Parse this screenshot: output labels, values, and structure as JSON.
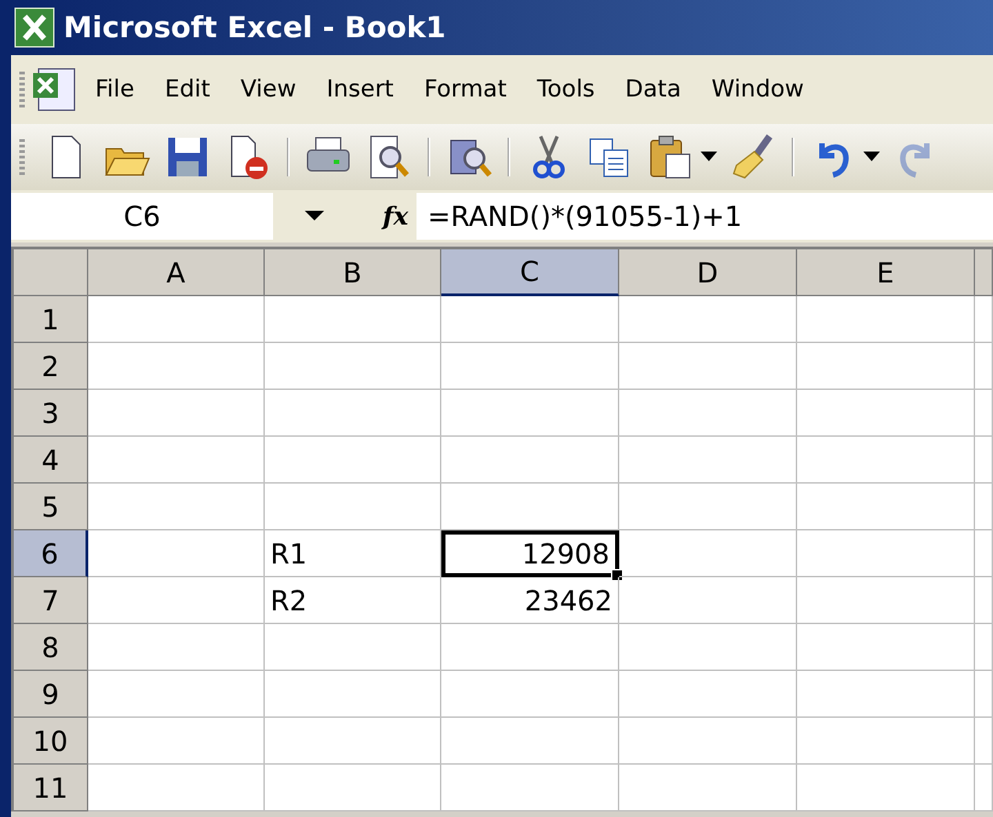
{
  "window": {
    "title": "Microsoft Excel - Book1"
  },
  "menu": [
    "File",
    "Edit",
    "View",
    "Insert",
    "Format",
    "Tools",
    "Data",
    "Window"
  ],
  "toolbar": [
    {
      "kind": "new",
      "disabled": false
    },
    {
      "kind": "open",
      "disabled": false
    },
    {
      "kind": "save",
      "disabled": false
    },
    {
      "kind": "permission",
      "disabled": false
    },
    {
      "kind": "separator"
    },
    {
      "kind": "print",
      "disabled": false
    },
    {
      "kind": "preview",
      "disabled": false
    },
    {
      "kind": "separator"
    },
    {
      "kind": "research",
      "disabled": false
    },
    {
      "kind": "separator"
    },
    {
      "kind": "cut",
      "disabled": false
    },
    {
      "kind": "copy",
      "disabled": false
    },
    {
      "kind": "paste",
      "disabled": false
    },
    {
      "kind": "dropdown"
    },
    {
      "kind": "painter",
      "disabled": false
    },
    {
      "kind": "separator"
    },
    {
      "kind": "undo",
      "disabled": false
    },
    {
      "kind": "dropdown"
    },
    {
      "kind": "redo",
      "disabled": true
    }
  ],
  "formula_bar": {
    "name_box": "C6",
    "function_label": "fx",
    "formula": "=RAND()*(91055-1)+1"
  },
  "sheet": {
    "columns": [
      {
        "label": "A",
        "selected": false
      },
      {
        "label": "B",
        "selected": false
      },
      {
        "label": "C",
        "selected": true
      },
      {
        "label": "D",
        "selected": false
      },
      {
        "label": "E",
        "selected": false
      }
    ],
    "rows": [
      {
        "label": "1",
        "selected": false,
        "cells": [
          {},
          {},
          {},
          {},
          {}
        ]
      },
      {
        "label": "2",
        "selected": false,
        "cells": [
          {},
          {},
          {},
          {},
          {}
        ]
      },
      {
        "label": "3",
        "selected": false,
        "cells": [
          {},
          {},
          {},
          {},
          {}
        ]
      },
      {
        "label": "4",
        "selected": false,
        "cells": [
          {},
          {},
          {},
          {},
          {}
        ]
      },
      {
        "label": "5",
        "selected": false,
        "cells": [
          {},
          {},
          {},
          {},
          {}
        ]
      },
      {
        "label": "6",
        "selected": true,
        "cells": [
          {},
          {
            "text": "R1",
            "kind": "text",
            "active": false
          },
          {
            "text": "12908",
            "kind": "number",
            "active": true
          },
          {},
          {}
        ]
      },
      {
        "label": "7",
        "selected": false,
        "cells": [
          {},
          {
            "text": "R2",
            "kind": "text",
            "active": false
          },
          {
            "text": "23462",
            "kind": "number",
            "active": false
          },
          {},
          {}
        ]
      },
      {
        "label": "8",
        "selected": false,
        "cells": [
          {},
          {},
          {},
          {},
          {}
        ]
      },
      {
        "label": "9",
        "selected": false,
        "cells": [
          {},
          {},
          {},
          {},
          {}
        ]
      },
      {
        "label": "10",
        "selected": false,
        "cells": [
          {},
          {},
          {},
          {},
          {}
        ]
      },
      {
        "label": "11",
        "selected": false,
        "cells": [
          {},
          {},
          {},
          {},
          {}
        ]
      }
    ]
  }
}
